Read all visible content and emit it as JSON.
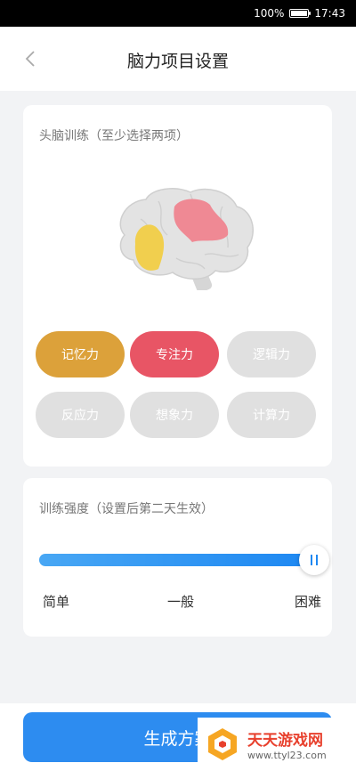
{
  "status_bar": {
    "battery_text": "100%",
    "time": "17:43"
  },
  "nav": {
    "title": "脑力项目设置",
    "back_icon": "chevron-left-icon"
  },
  "brain_training": {
    "title": "头脑训练（至少选择两项）",
    "options": [
      {
        "label": "记忆力",
        "selected": true,
        "color": "#dca13a"
      },
      {
        "label": "专注力",
        "selected": true,
        "color": "#e85565"
      },
      {
        "label": "逻辑力",
        "selected": false,
        "color": "#e0e0e0"
      },
      {
        "label": "反应力",
        "selected": false,
        "color": "#e0e0e0"
      },
      {
        "label": "想象力",
        "selected": false,
        "color": "#e0e0e0"
      },
      {
        "label": "计算力",
        "selected": false,
        "color": "#e0e0e0"
      }
    ]
  },
  "intensity": {
    "title": "训练强度（设置后第二天生效）",
    "levels": [
      "简单",
      "一般",
      "困难"
    ],
    "value_fraction": 1.0
  },
  "generate_button": {
    "label": "生成方案"
  },
  "watermark": {
    "main": "天天游戏网",
    "url": "www.ttyl23.com"
  }
}
